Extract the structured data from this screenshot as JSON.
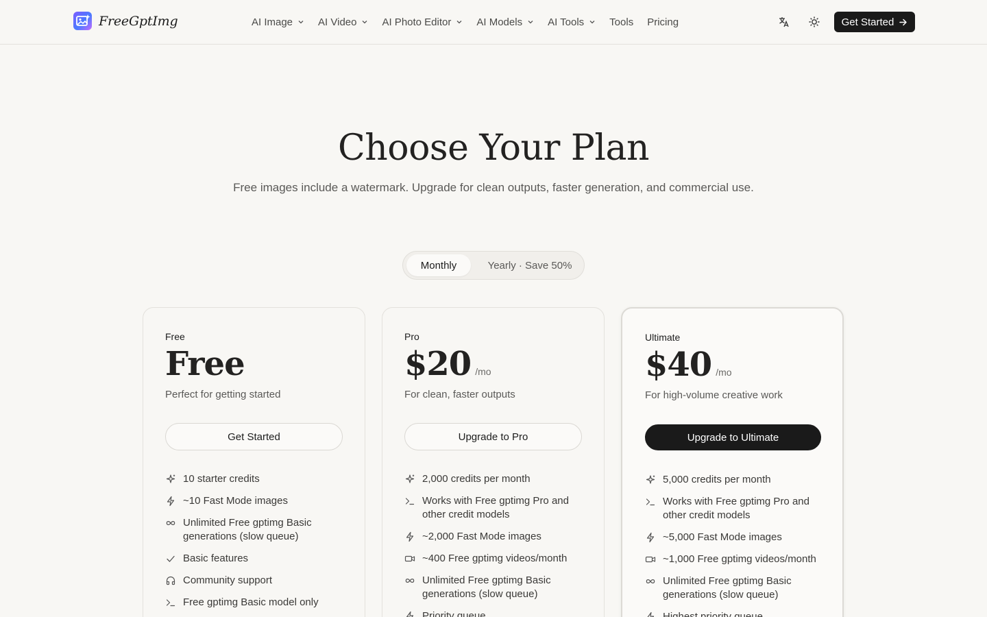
{
  "brand": {
    "name": "FreeGptImg"
  },
  "nav": {
    "items": [
      {
        "label": "AI Image",
        "dropdown": true
      },
      {
        "label": "AI Video",
        "dropdown": true
      },
      {
        "label": "AI Photo Editor",
        "dropdown": true
      },
      {
        "label": "AI Models",
        "dropdown": true
      },
      {
        "label": "AI Tools",
        "dropdown": true
      },
      {
        "label": "Tools",
        "dropdown": false
      },
      {
        "label": "Pricing",
        "dropdown": false
      }
    ],
    "cta": "Get Started"
  },
  "hero": {
    "title": "Choose Your Plan",
    "subtitle": "Free images include a watermark. Upgrade for clean outputs, faster generation, and commercial use."
  },
  "billing_toggle": {
    "active": "Monthly",
    "inactive": "Yearly · Save 50%"
  },
  "plans": [
    {
      "name": "Free",
      "price": "Free",
      "period": "",
      "description": "Perfect for getting started",
      "button": "Get Started",
      "features": [
        {
          "icon": "sparkles-icon",
          "text": "10 starter credits"
        },
        {
          "icon": "lightning-icon",
          "text": "~10 Fast Mode images"
        },
        {
          "icon": "infinity-icon",
          "text": "Unlimited Free gptimg Basic generations (slow queue)"
        },
        {
          "icon": "check-icon",
          "text": "Basic features"
        },
        {
          "icon": "headphones-icon",
          "text": "Community support"
        },
        {
          "icon": "terminal-icon",
          "text": "Free gptimg Basic model only"
        }
      ]
    },
    {
      "name": "Pro",
      "price": "$20",
      "period": "/mo",
      "description": "For clean, faster outputs",
      "button": "Upgrade to Pro",
      "features": [
        {
          "icon": "sparkles-icon",
          "text": "2,000 credits per month"
        },
        {
          "icon": "terminal-icon",
          "text": "Works with Free gptimg Pro and other credit models"
        },
        {
          "icon": "lightning-icon",
          "text": "~2,000 Fast Mode images"
        },
        {
          "icon": "video-icon",
          "text": "~400 Free gptimg videos/month"
        },
        {
          "icon": "infinity-icon",
          "text": "Unlimited Free gptimg Basic generations (slow queue)"
        },
        {
          "icon": "lightning-icon",
          "text": "Priority queue"
        }
      ]
    },
    {
      "name": "Ultimate",
      "price": "$40",
      "period": "/mo",
      "description": "For high-volume creative work",
      "button": "Upgrade to Ultimate",
      "features": [
        {
          "icon": "sparkles-icon",
          "text": "5,000 credits per month"
        },
        {
          "icon": "terminal-icon",
          "text": "Works with Free gptimg Pro and other credit models"
        },
        {
          "icon": "lightning-icon",
          "text": "~5,000 Fast Mode images"
        },
        {
          "icon": "video-icon",
          "text": "~1,000 Free gptimg videos/month"
        },
        {
          "icon": "infinity-icon",
          "text": "Unlimited Free gptimg Basic generations (slow queue)"
        },
        {
          "icon": "lightning-icon",
          "text": "Highest priority queue"
        }
      ]
    }
  ]
}
